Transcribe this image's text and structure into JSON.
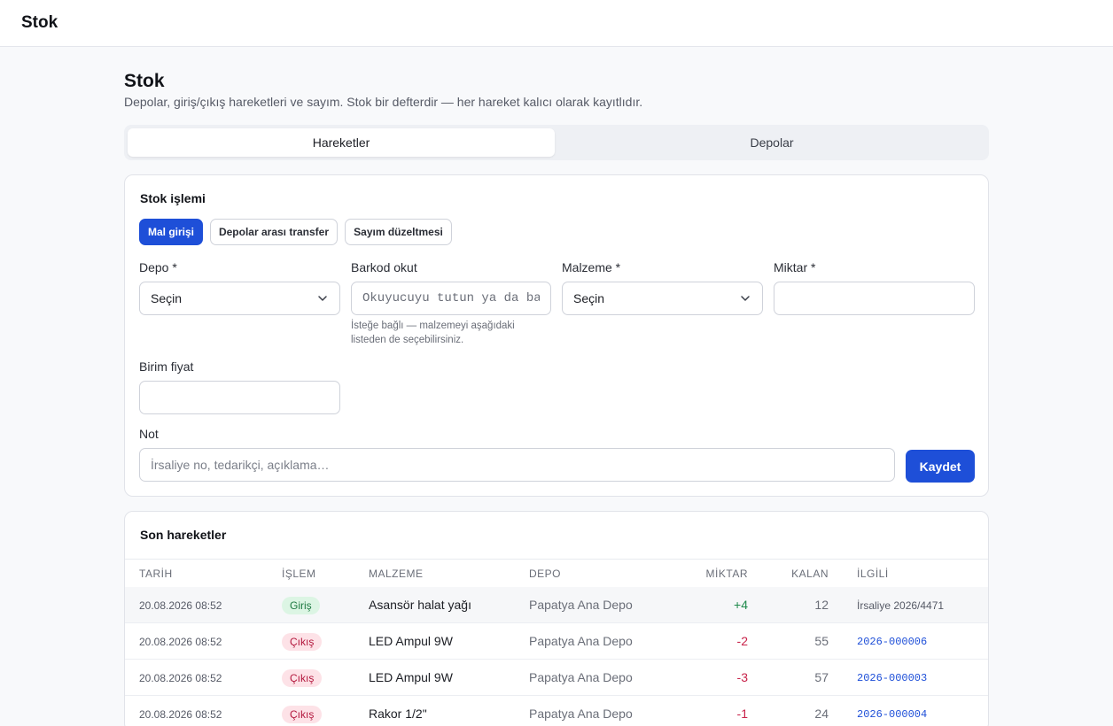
{
  "app": {
    "title": "Stok"
  },
  "page": {
    "title": "Stok",
    "subtitle": "Depolar, giriş/çıkış hareketleri ve sayım. Stok bir defterdir — her hareket kalıcı olarak kayıtlıdır."
  },
  "tabs": [
    {
      "label": "Hareketler",
      "active": true
    },
    {
      "label": "Depolar",
      "active": false
    }
  ],
  "form": {
    "title": "Stok işlemi",
    "types": [
      {
        "label": "Mal girişi",
        "active": true
      },
      {
        "label": "Depolar arası transfer",
        "active": false
      },
      {
        "label": "Sayım düzeltmesi",
        "active": false
      }
    ],
    "depo": {
      "label": "Depo *",
      "value": "Seçin"
    },
    "barkod": {
      "label": "Barkod okut",
      "placeholder": "Okuyucuyu tutun ya da basın",
      "help": "İsteğe bağlı — malzemeyi aşağıdaki listeden de seçebilirsiniz."
    },
    "malzeme": {
      "label": "Malzeme *",
      "value": "Seçin"
    },
    "miktar": {
      "label": "Miktar *",
      "value": ""
    },
    "birim_fiyat": {
      "label": "Birim fiyat",
      "value": ""
    },
    "not": {
      "label": "Not",
      "placeholder": "İrsaliye no, tedarikçi, açıklama…"
    },
    "save_label": "Kaydet"
  },
  "movements": {
    "title": "Son hareketler",
    "columns": [
      "TARİH",
      "İŞLEM",
      "MALZEME",
      "DEPO",
      "MİKTAR",
      "KALAN",
      "İLGİLİ"
    ],
    "rows": [
      {
        "date": "20.08.2026 08:52",
        "type": "Giriş",
        "kind": "in",
        "item": "Asansör halat yağı",
        "depo": "Papatya Ana Depo",
        "qty": "+4",
        "remaining": "12",
        "related": "İrsaliye 2026/4471",
        "related_is_link": false
      },
      {
        "date": "20.08.2026 08:52",
        "type": "Çıkış",
        "kind": "out",
        "item": "LED Ampul 9W",
        "depo": "Papatya Ana Depo",
        "qty": "-2",
        "remaining": "55",
        "related": "2026-000006",
        "related_is_link": true
      },
      {
        "date": "20.08.2026 08:52",
        "type": "Çıkış",
        "kind": "out",
        "item": "LED Ampul 9W",
        "depo": "Papatya Ana Depo",
        "qty": "-3",
        "remaining": "57",
        "related": "2026-000003",
        "related_is_link": true
      },
      {
        "date": "20.08.2026 08:52",
        "type": "Çıkış",
        "kind": "out",
        "item": "Rakor 1/2\"",
        "depo": "Papatya Ana Depo",
        "qty": "-1",
        "remaining": "24",
        "related": "2026-000004",
        "related_is_link": true
      }
    ]
  },
  "colors": {
    "accent": "#1e4fd8",
    "positive": "#1f8a4c",
    "negative": "#c8234a"
  }
}
